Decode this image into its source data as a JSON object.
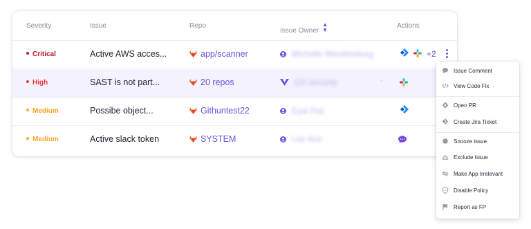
{
  "columns": {
    "severity": "Severity",
    "issue": "Issue",
    "repo": "Repo",
    "owner": "Issue Owner",
    "actions": "Actions"
  },
  "rows": [
    {
      "severity": "Critical",
      "severity_color": "#c0162c",
      "issue": "Active AWS acces...",
      "repo": "app/scanner",
      "owner": "Michelle Wendelsburg",
      "actions": [
        "jira",
        "slack"
      ],
      "more": "+2"
    },
    {
      "severity": "High",
      "severity_color": "#e8383d",
      "issue": "SAST is not part...",
      "repo": "20 repos",
      "owner": "OX security",
      "owner_icon": "team",
      "actions": [
        "slack"
      ]
    },
    {
      "severity": "Medium",
      "severity_color": "#f5a623",
      "issue": "Possibe object...",
      "repo": "Githuntest22",
      "owner": "Eyal Paz",
      "actions": [
        "jira"
      ]
    },
    {
      "severity": "Medium",
      "severity_color": "#f5a623",
      "issue": "Active slack token",
      "repo": "SYSTEM",
      "owner": "Lior Arzi",
      "actions": [
        "comment"
      ]
    }
  ],
  "menu": {
    "items": [
      {
        "label": "Issue Comment",
        "icon": "comment-icon"
      },
      {
        "label": "View Code Fix",
        "icon": "code-icon"
      },
      {
        "label": "Open PR",
        "icon": "pull-request-icon"
      },
      {
        "label": "Create Jira Ticket",
        "icon": "jira-icon"
      },
      {
        "label": "Snooze issue",
        "icon": "snooze-icon"
      },
      {
        "label": "Exclude Issue",
        "icon": "exclude-icon"
      },
      {
        "label": "Make App Irrelevant",
        "icon": "eye-off-icon"
      },
      {
        "label": "Disable Policy",
        "icon": "shield-off-icon"
      },
      {
        "label": "Report as FP",
        "icon": "flag-icon"
      }
    ]
  },
  "colors": {
    "accent": "#6a55e0",
    "gitlab": "#fc6d26",
    "jira": "#2684ff"
  }
}
